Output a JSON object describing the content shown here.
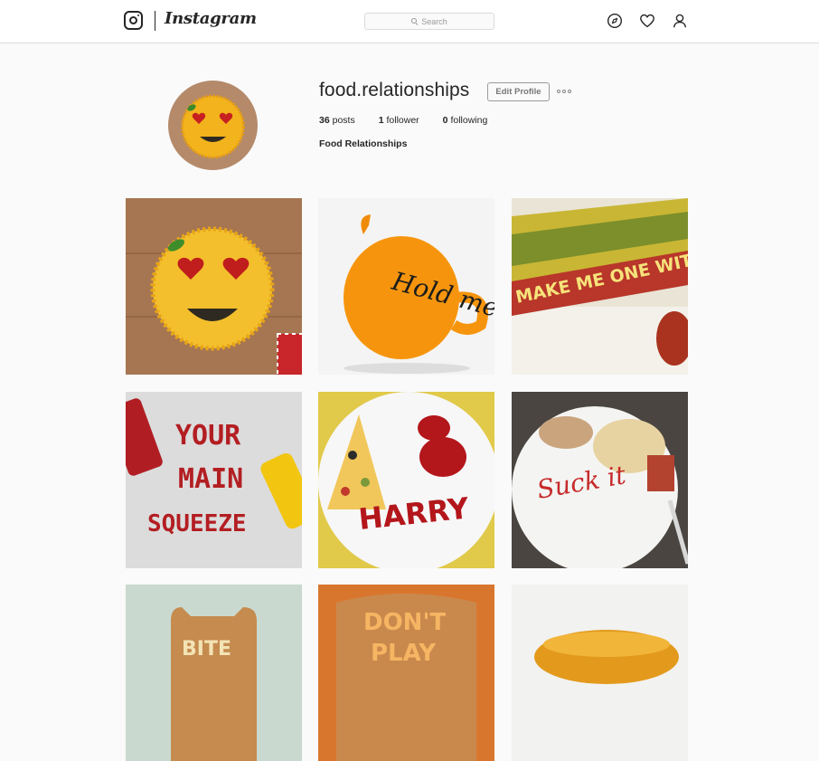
{
  "nav": {
    "brand": "Instagram",
    "search_placeholder": "Search",
    "icons": [
      "instagram-logo-icon",
      "compass-icon",
      "heart-icon",
      "person-icon"
    ]
  },
  "profile": {
    "username": "food.relationships",
    "edit_label": "Edit Profile",
    "posts_count": "36",
    "posts_label": "posts",
    "followers_count": "1",
    "followers_label": "follower",
    "following_count": "0",
    "following_label": "following",
    "full_name": "Food Relationships"
  },
  "grid": {
    "posts": [
      {
        "text": ""
      },
      {
        "text": "Hold me"
      },
      {
        "text": "MAKE ME ONE WITH"
      },
      {
        "text_lines": [
          "YOUR",
          "MAIN",
          "SQUEEZE"
        ]
      },
      {
        "text": "HARRY"
      },
      {
        "text": "Suck it"
      },
      {
        "text": "BITE"
      },
      {
        "text_lines": [
          "DON'T",
          "PLAY"
        ]
      },
      {
        "text": ""
      }
    ]
  },
  "colors": {
    "border": "#dbdbdb",
    "text": "#262626",
    "background": "#fafafa"
  }
}
